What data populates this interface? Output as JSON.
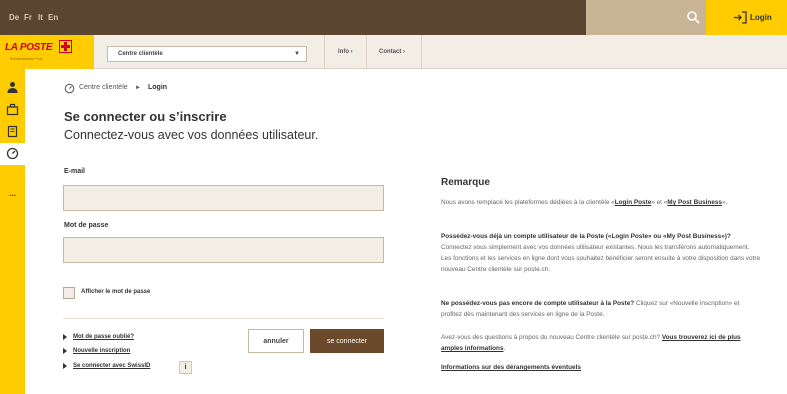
{
  "header": {
    "languages": [
      "De",
      "Fr",
      "It",
      "En"
    ],
    "login_label": "Login",
    "colors": {
      "topbar": "#5a4630",
      "accent": "#ffcc00",
      "brand_red": "#d2001e",
      "button_dark": "#6b4a2b"
    }
  },
  "logo": {
    "text": "LA POSTE",
    "tagline": "Schweizerische Post",
    "icon": "swiss-cross-icon"
  },
  "nav": {
    "area_select_value": "Centre clientèle",
    "links": [
      "Info ›",
      "Contact ›"
    ]
  },
  "sidebar": {
    "icons": [
      "person-icon",
      "briefcase-icon",
      "book-icon",
      "gauge-icon"
    ],
    "more": "..."
  },
  "breadcrumb": {
    "home": "Centre clientèle",
    "separator": "►",
    "current": "Login"
  },
  "page": {
    "title": "Se connecter ou s’inscrire",
    "subtitle": "Connectez-vous avec vos données utilisateur."
  },
  "form": {
    "email_label": "E-mail",
    "email_value": "",
    "password_label": "Mot de passe",
    "password_value": "",
    "show_password_label": "Afficher le mot de passe",
    "cancel_label": "annuler",
    "submit_label": "se connecter",
    "links": [
      "Mot de passe oublié?",
      "Nouvelle inscription",
      "Se connecter avec SwissID"
    ],
    "info_badge": "i"
  },
  "notes": {
    "title": "Remarque",
    "p1_text": "Nous avons remplacé les plateformes dédiées à la clientèle «",
    "p1_link1": "Login Poste",
    "p1_mid": "» et «",
    "p1_link2": "My Post Business",
    "p1_end": "».",
    "p2_bold": "Possédez-vous déjà un compte utilisateur de la Poste («Login Poste» ou «My Post Business»)?",
    "p2_text": " Connectez vous simplement avec vos données utilisateur existantes. Nous les transférons automatiquement. Les fonctions et les services en ligne dont vous souhaitez bénéficier seront ensuite à votre disposition dans votre nouveau Centre clientèle sur poste.ch.",
    "p3_bold": "Ne possédez-vous pas encore de compte utilisateur à la Poste?",
    "p3_text": " Cliquez sur «Nouvelle inscription» et profitez dès maintenant des services en ligne de la Poste.",
    "p4_text": "Avez-vous des questions à propos du nouveau Centre clientèle sur poste.ch? ",
    "p4_link": "Vous trouverez ici de plus amples informations",
    "p4_end": ".",
    "link_disruptions": "Informations sur des dérangements éventuels"
  }
}
